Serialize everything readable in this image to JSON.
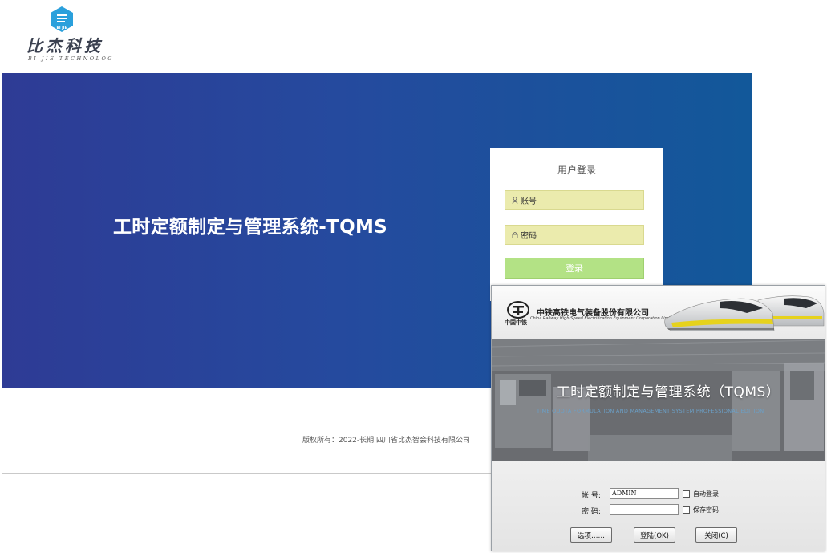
{
  "web": {
    "logo": {
      "cn": "比杰科技",
      "en": "BI JIE TECHNOLOG",
      "badge": "BI JIE",
      "icon": "hexagon-logo-icon"
    },
    "system_title": "工时定额制定与管理系统-TQMS",
    "login": {
      "title": "用户登录",
      "account_placeholder": "账号",
      "password_placeholder": "密码",
      "submit_label": "登录"
    },
    "copyright": "版权所有：2022-长期 四川省比杰智会科技有限公司",
    "colors": {
      "banner_start": "#2e3b95",
      "banner_end": "#12589a",
      "field_bg": "#ebebad",
      "button_bg": "#b3e285"
    }
  },
  "desktop": {
    "company": {
      "cn": "中铁高铁电气装备股份有限公司",
      "en": "China Railway High-Speed Electrification Equipment Corporation Limited",
      "logo_caption": "中国中铁",
      "icon": "crrc-logo-icon"
    },
    "title": "工时定额制定与管理系统（TQMS）",
    "subtitle": "TIME QUOTA FORMULATION AND MANAGEMENT SYSTEM PROFESSIONAL EDITION",
    "form": {
      "account_label": "帐  号:",
      "account_value": "ADMIN",
      "password_label": "密  码:",
      "password_value": "",
      "auto_login_label": "自动登录",
      "auto_login_checked": false,
      "save_password_label": "保存密码",
      "save_password_checked": false
    },
    "buttons": {
      "options": "选项……",
      "login": "登陆(OK)",
      "close": "关闭(C)"
    }
  }
}
